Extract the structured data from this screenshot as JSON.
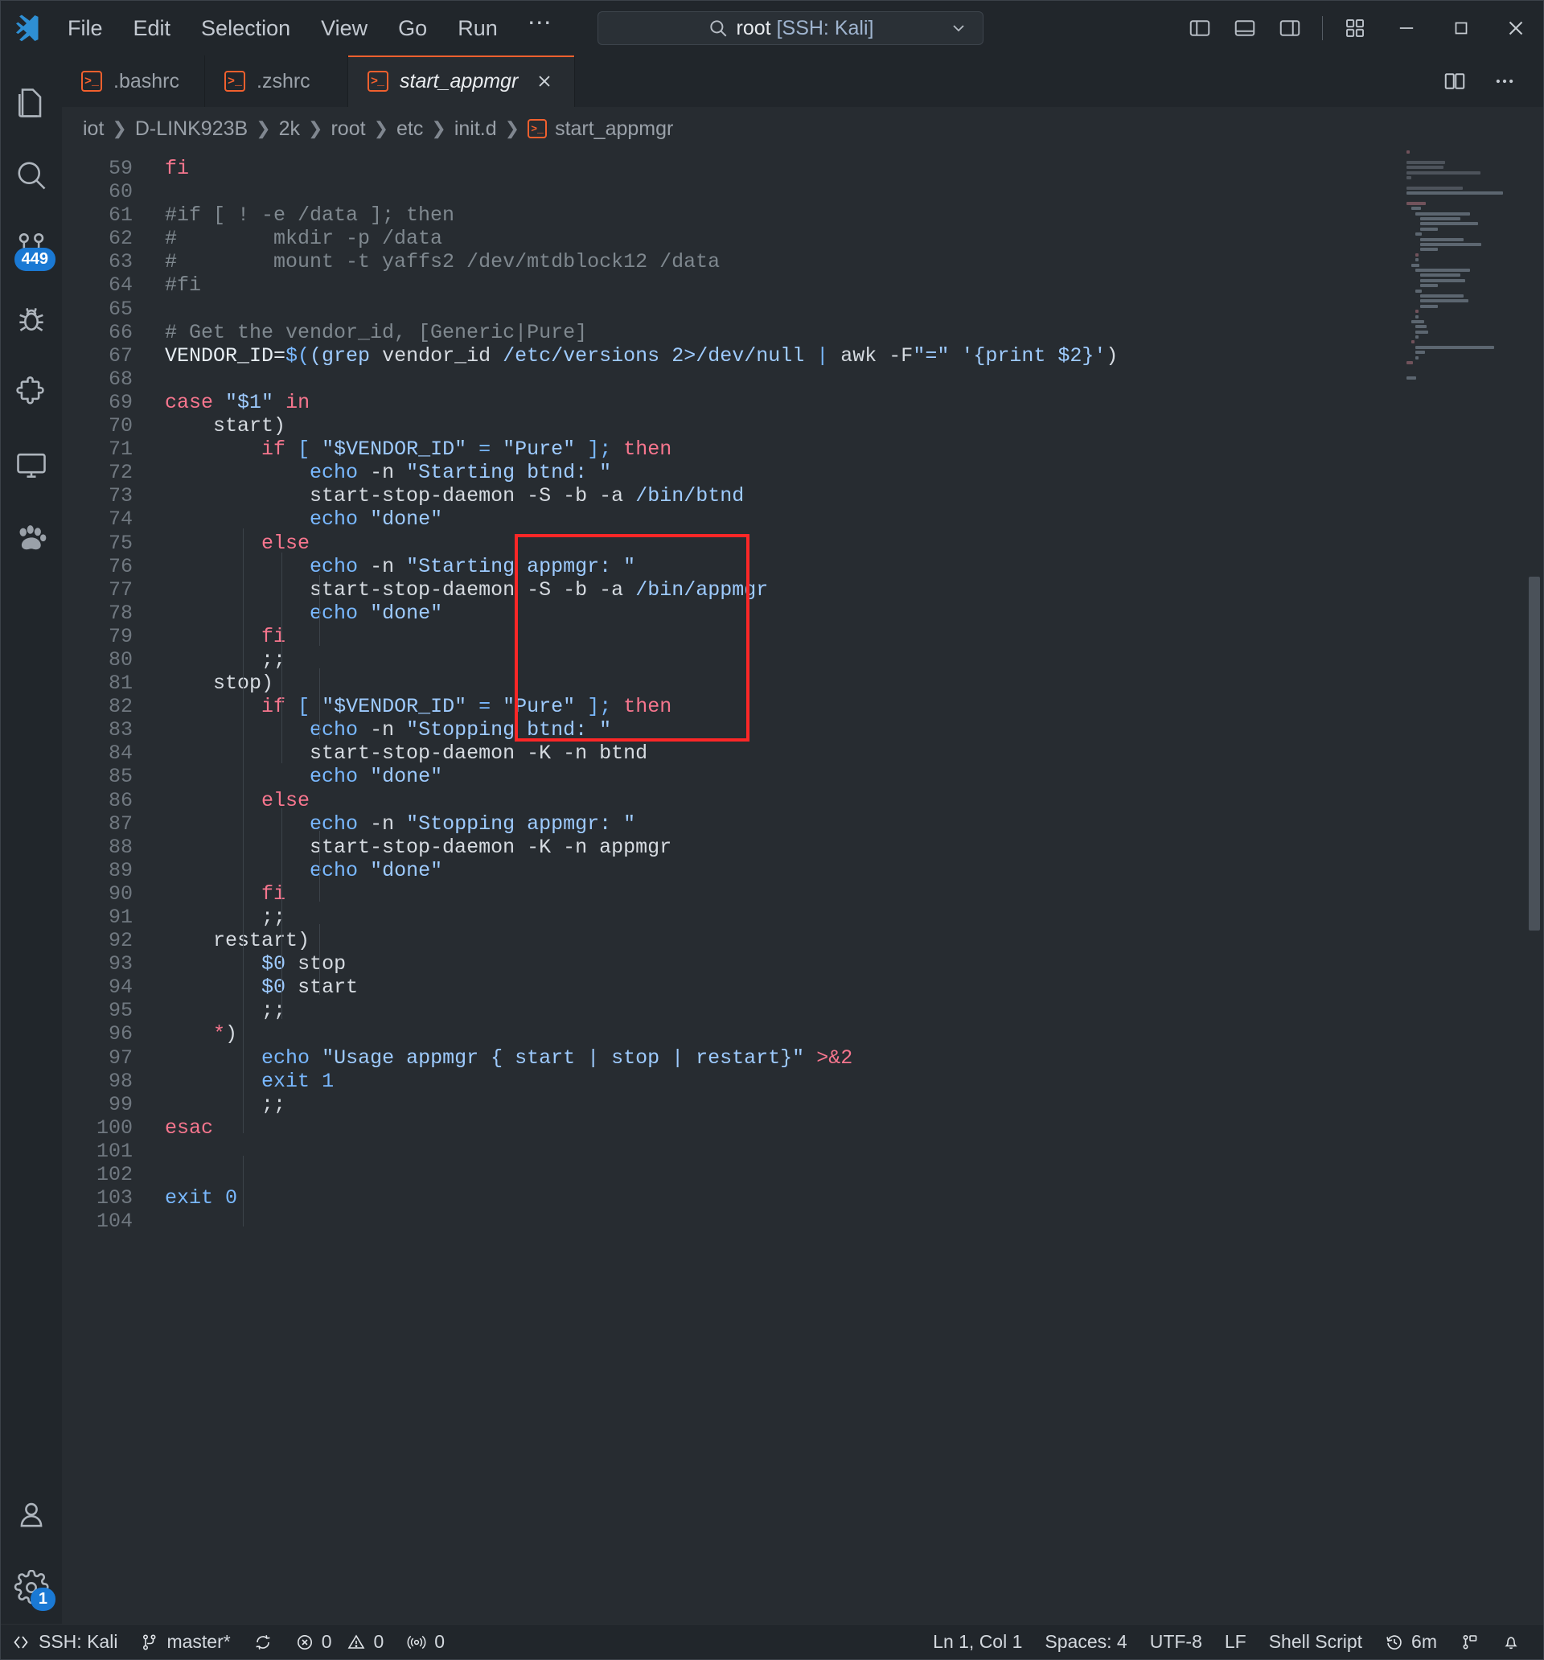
{
  "window": {
    "title": "root [SSH: Kali]",
    "title_prefix": "root ",
    "title_bracket": "[SSH: Kali]",
    "menu": [
      "File",
      "Edit",
      "Selection",
      "View",
      "Go",
      "Run"
    ],
    "menu_overflow": "⋯",
    "nav_back": "←",
    "nav_forward": "→",
    "search_icon": "search-icon",
    "chevron": "⌄",
    "controls": {
      "minimize": "—",
      "maximize": "□",
      "close": "✕"
    }
  },
  "activitybar": {
    "items": [
      {
        "name": "explorer",
        "label": "Explorer",
        "badge": ""
      },
      {
        "name": "search",
        "label": "Search",
        "badge": ""
      },
      {
        "name": "source-control",
        "label": "Source Control",
        "badge": "449"
      },
      {
        "name": "run-and-debug",
        "label": "Run and Debug",
        "badge": ""
      },
      {
        "name": "extensions",
        "label": "Extensions",
        "badge": ""
      },
      {
        "name": "remote-explorer",
        "label": "Remote Explorer",
        "badge": ""
      },
      {
        "name": "paw",
        "label": "Kali",
        "badge": ""
      }
    ],
    "bottom": [
      {
        "name": "accounts",
        "label": "Accounts",
        "badge": ""
      },
      {
        "name": "settings",
        "label": "Manage",
        "badge": "1"
      }
    ]
  },
  "tabs": [
    {
      "label": ".bashrc",
      "active": false,
      "icon": "shell-file-icon"
    },
    {
      "label": ".zshrc",
      "active": false,
      "icon": "shell-file-icon"
    },
    {
      "label": "start_appmgr",
      "active": true,
      "icon": "shell-file-icon"
    }
  ],
  "breadcrumbs": [
    "iot",
    "D-LINK923B",
    "2k",
    "root",
    "etc",
    "init.d",
    "start_appmgr"
  ],
  "editor": {
    "first_line": 59,
    "last_line": 104,
    "annotation": {
      "color": "#fb2727",
      "label": "red-highlight-box"
    },
    "lines": [
      {
        "n": 59,
        "text": "fi"
      },
      {
        "n": 60,
        "text": ""
      },
      {
        "n": 61,
        "text": "#if [ ! -e /data ]; then"
      },
      {
        "n": 62,
        "text": "#        mkdir -p /data"
      },
      {
        "n": 63,
        "text": "#        mount -t yaffs2 /dev/mtdblock12 /data"
      },
      {
        "n": 64,
        "text": "#fi"
      },
      {
        "n": 65,
        "text": ""
      },
      {
        "n": 66,
        "text": "# Get the vendor_id, [Generic|Pure]"
      },
      {
        "n": 67,
        "text": "VENDOR_ID=$(grep vendor_id /etc/versions 2>/dev/null | awk -F\"=\" '{print $2}')"
      },
      {
        "n": 68,
        "text": ""
      },
      {
        "n": 69,
        "text": "case \"$1\" in"
      },
      {
        "n": 70,
        "text": "    start)"
      },
      {
        "n": 71,
        "text": "        if [ \"$VENDOR_ID\" = \"Pure\" ]; then"
      },
      {
        "n": 72,
        "text": "            echo -n \"Starting btnd: \""
      },
      {
        "n": 73,
        "text": "            start-stop-daemon -S -b -a /bin/btnd"
      },
      {
        "n": 74,
        "text": "            echo \"done\""
      },
      {
        "n": 75,
        "text": "        else"
      },
      {
        "n": 76,
        "text": "            echo -n \"Starting appmgr: \""
      },
      {
        "n": 77,
        "text": "            start-stop-daemon -S -b -a /bin/appmgr"
      },
      {
        "n": 78,
        "text": "            echo \"done\""
      },
      {
        "n": 79,
        "text": "        fi"
      },
      {
        "n": 80,
        "text": "        ;;"
      },
      {
        "n": 81,
        "text": "    stop)"
      },
      {
        "n": 82,
        "text": "        if [ \"$VENDOR_ID\" = \"Pure\" ]; then"
      },
      {
        "n": 83,
        "text": "            echo -n \"Stopping btnd: \""
      },
      {
        "n": 84,
        "text": "            start-stop-daemon -K -n btnd"
      },
      {
        "n": 85,
        "text": "            echo \"done\""
      },
      {
        "n": 86,
        "text": "        else"
      },
      {
        "n": 87,
        "text": "            echo -n \"Stopping appmgr: \""
      },
      {
        "n": 88,
        "text": "            start-stop-daemon -K -n appmgr"
      },
      {
        "n": 89,
        "text": "            echo \"done\""
      },
      {
        "n": 90,
        "text": "        fi"
      },
      {
        "n": 91,
        "text": "        ;;"
      },
      {
        "n": 92,
        "text": "    restart)"
      },
      {
        "n": 93,
        "text": "        $0 stop"
      },
      {
        "n": 94,
        "text": "        $0 start"
      },
      {
        "n": 95,
        "text": "        ;;"
      },
      {
        "n": 96,
        "text": "    *)"
      },
      {
        "n": 97,
        "text": "        echo \"Usage appmgr { start | stop | restart}\" >&2"
      },
      {
        "n": 98,
        "text": "        exit 1"
      },
      {
        "n": 99,
        "text": "        ;;"
      },
      {
        "n": 100,
        "text": "esac"
      },
      {
        "n": 101,
        "text": ""
      },
      {
        "n": 102,
        "text": ""
      },
      {
        "n": 103,
        "text": "exit 0"
      },
      {
        "n": 104,
        "text": ""
      }
    ]
  },
  "statusbar": {
    "remote": "SSH: Kali",
    "branch": "master*",
    "sync_icon": "sync-icon",
    "errors": "0",
    "warnings": "0",
    "ports": "0",
    "cursor": "Ln 1, Col 1",
    "indent": "Spaces: 4",
    "encoding": "UTF-8",
    "eol": "LF",
    "language": "Shell Script",
    "timer": "6m",
    "feedback_icon": "feedback-icon",
    "bell_icon": "bell-icon"
  },
  "colors": {
    "accent_orange": "#f1602e",
    "annotation_red": "#fb2727",
    "badge_blue": "#1a79d4",
    "editor_bg": "#272c31",
    "chrome_bg": "#21262b"
  }
}
